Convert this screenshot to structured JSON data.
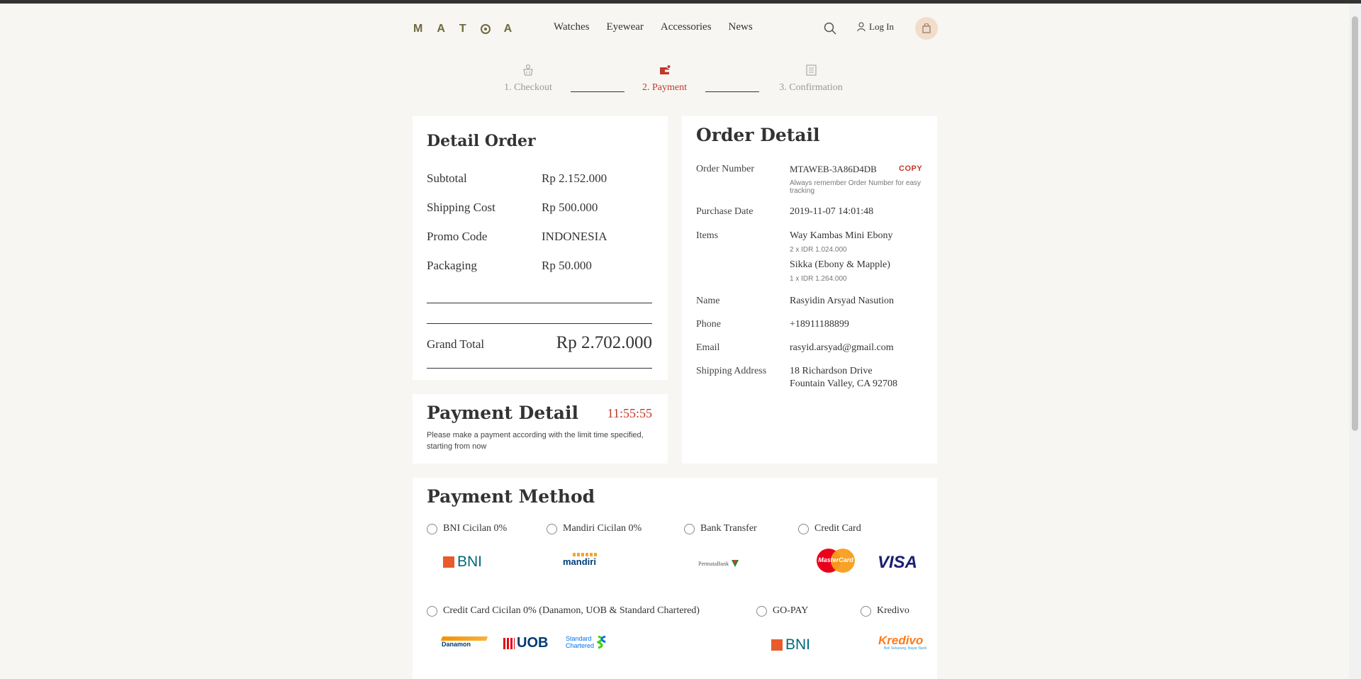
{
  "header": {
    "logo_letters": [
      "M",
      "A",
      "T",
      "O",
      "A"
    ],
    "nav": [
      "Watches",
      "Eyewear",
      "Accessories",
      "News"
    ],
    "login_label": "Log In"
  },
  "steps": [
    {
      "label": "1. Checkout",
      "active": false
    },
    {
      "label": "2. Payment",
      "active": true
    },
    {
      "label": "3. Confirmation",
      "active": false
    }
  ],
  "detail_order": {
    "title": "Detail Order",
    "rows": [
      {
        "label": "Subtotal",
        "value": "Rp 2.152.000"
      },
      {
        "label": "Shipping Cost",
        "value": "Rp 500.000"
      },
      {
        "label": "Promo Code",
        "value": "INDONESIA"
      },
      {
        "label": "Packaging",
        "value": "Rp 50.000"
      }
    ],
    "grand_total_label": "Grand Total",
    "grand_total_value": "Rp 2.702.000"
  },
  "payment_detail": {
    "title": "Payment Detail",
    "timer": "11:55:55",
    "note": "Please make a payment according with the limit time specified, starting from now"
  },
  "order_detail": {
    "title": "Order Detail",
    "order_number_label": "Order Number",
    "order_number": "MTAWEB-3A86D4DB",
    "copy_label": "COPY",
    "order_number_hint": "Always remember Order Number for easy tracking",
    "purchase_date_label": "Purchase Date",
    "purchase_date": "2019-11-07 14:01:48",
    "items_label": "Items",
    "items": [
      {
        "name": "Way Kambas Mini Ebony",
        "detail": "2 x IDR 1.024.000"
      },
      {
        "name": "Sikka (Ebony & Mapple)",
        "detail": "1 x IDR 1.264.000"
      }
    ],
    "name_label": "Name",
    "name": "Rasyidin Arsyad Nasution",
    "phone_label": "Phone",
    "phone": "+18911188899",
    "email_label": "Email",
    "email": "rasyid.arsyad@gmail.com",
    "address_label": "Shipping Address",
    "address_line1": "18 Richardson Drive",
    "address_line2": "Fountain Valley, CA 92708"
  },
  "payment_method": {
    "title": "Payment Method",
    "options": [
      "BNI Cicilan 0%",
      "Mandiri Cicilan 0%",
      "Bank Transfer",
      "Credit Card",
      "Credit Card Cicilan 0% (Danamon, UOB & Standard Chartered)",
      "GO-PAY",
      "Kredivo"
    ],
    "logos": {
      "bni": "BNI",
      "mandiri": "mandiri",
      "permata": "PermataBank",
      "mastercard": "MasterCard",
      "visa": "VISA",
      "danamon": "Danamon",
      "uob": "UOB",
      "standard_chartered_1": "Standard",
      "standard_chartered_2": "Chartered",
      "bni2": "BNI",
      "kredivo": "Kredivo",
      "kredivo_tagline": "Beli Sekarang, Bayar Nanti"
    }
  },
  "colors": {
    "accent": "#c0392b",
    "logo": "#6e6a3a",
    "cart_bg": "#f3dcc9"
  }
}
